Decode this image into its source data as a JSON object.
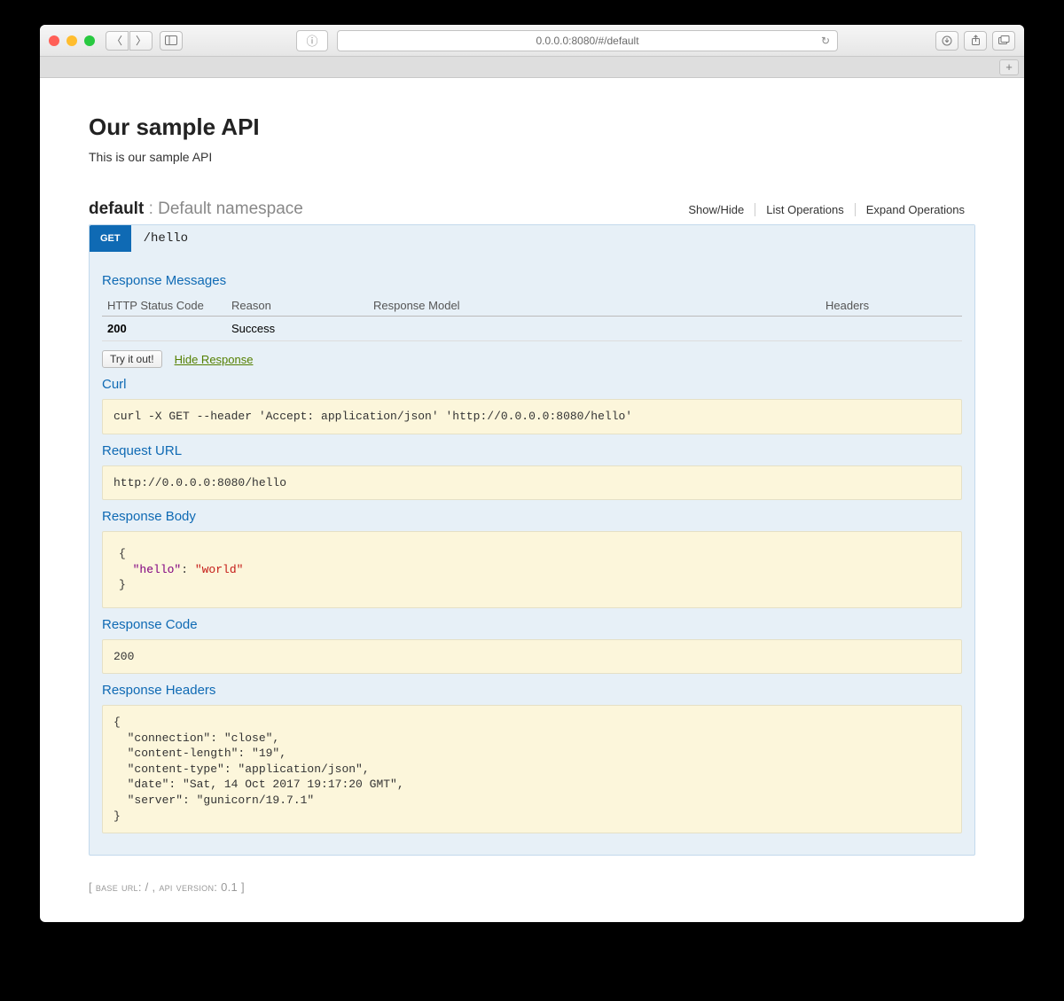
{
  "browser": {
    "url": "0.0.0.0:8080/#/default"
  },
  "api": {
    "title": "Our sample API",
    "description": "This is our sample API"
  },
  "namespace": {
    "name": "default",
    "desc": "Default namespace",
    "actions": {
      "showHide": "Show/Hide",
      "listOps": "List Operations",
      "expandOps": "Expand Operations"
    }
  },
  "operation": {
    "method": "GET",
    "path": "/hello",
    "respMessagesTitle": "Response Messages",
    "table": {
      "col1": "HTTP Status Code",
      "col2": "Reason",
      "col3": "Response Model",
      "col4": "Headers",
      "statusCode": "200",
      "reason": "Success"
    },
    "tryItOut": "Try it out!",
    "hideResponse": "Hide Response",
    "curlTitle": "Curl",
    "curl": "curl -X GET --header 'Accept: application/json' 'http://0.0.0.0:8080/hello'",
    "requestUrlTitle": "Request URL",
    "requestUrl": "http://0.0.0.0:8080/hello",
    "responseBodyTitle": "Response Body",
    "responseBody": {
      "key": "\"hello\"",
      "value": "\"world\""
    },
    "responseCodeTitle": "Response Code",
    "responseCode": "200",
    "responseHeadersTitle": "Response Headers",
    "responseHeaders": "{\n  \"connection\": \"close\",\n  \"content-length\": \"19\",\n  \"content-type\": \"application/json\",\n  \"date\": \"Sat, 14 Oct 2017 19:17:20 GMT\",\n  \"server\": \"gunicorn/19.7.1\"\n}"
  },
  "footer": {
    "text": "[ base url: / , api version: 0.1 ]"
  }
}
